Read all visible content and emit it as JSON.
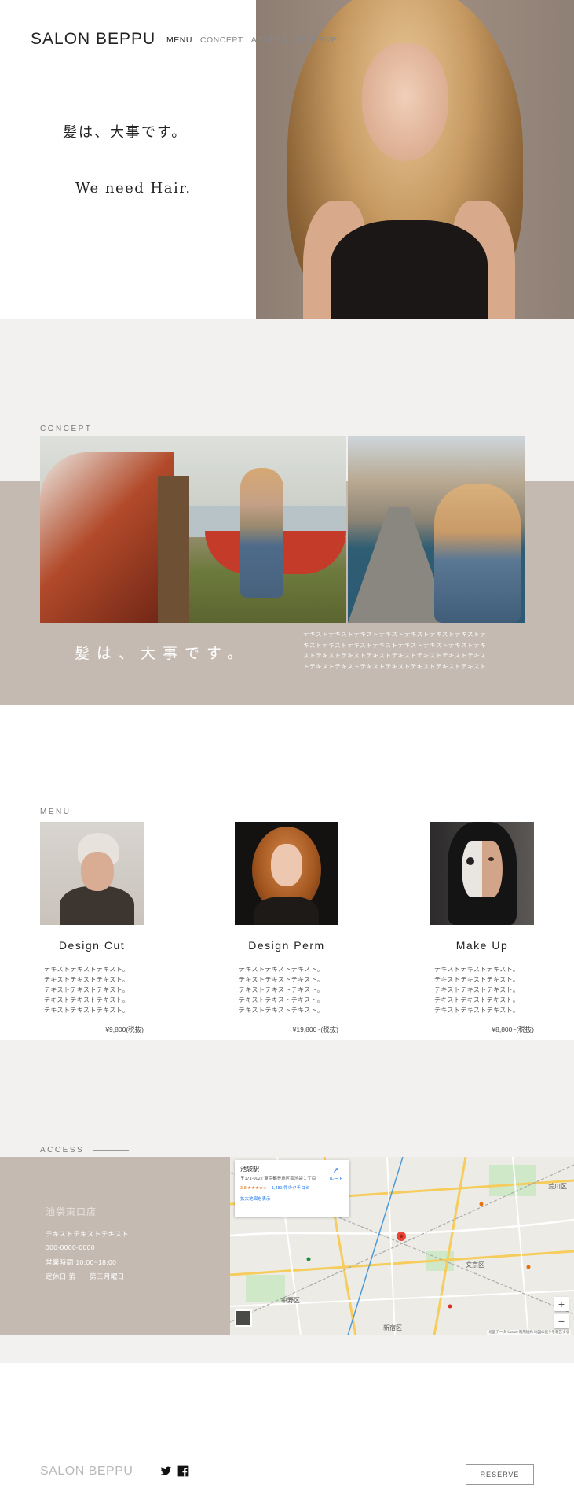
{
  "header": {
    "logo": "SALON BEPPU",
    "nav": [
      {
        "label": "MENU"
      },
      {
        "label": "CONCEPT"
      },
      {
        "label": "ACCESS"
      },
      {
        "label": "RESERVE"
      }
    ]
  },
  "hero": {
    "title_jp": "髪は、大事です。",
    "title_en": "We need Hair."
  },
  "concept": {
    "label": "CONCEPT",
    "heading": "髪は、大事です。",
    "text": "テキストテキストテキストテキストテキストテキストテキストテキストテキストテキストテキストテキストテキストテキストテキストテキストテキストテキストテキストテキストテキストテキストテキストテキストテキストテキストテキストテキストテキスト"
  },
  "menu": {
    "label": "MENU",
    "items": [
      {
        "title": "Design Cut",
        "desc": [
          "テキストテキストテキスト。",
          "テキストテキストテキスト。",
          "テキストテキストテキスト。",
          "テキストテキストテキスト。",
          "テキストテキストテキスト。"
        ],
        "price": "¥9,800(税抜)"
      },
      {
        "title": "Design Perm",
        "desc": [
          "テキストテキストテキスト。",
          "テキストテキストテキスト。",
          "テキストテキストテキスト。",
          "テキストテキストテキスト。",
          "テキストテキストテキスト。"
        ],
        "price": "¥19,800~(税抜)"
      },
      {
        "title": "Make Up",
        "desc": [
          "テキストテキストテキスト。",
          "テキストテキストテキスト。",
          "テキストテキストテキスト。",
          "テキストテキストテキスト。",
          "テキストテキストテキスト。"
        ],
        "price": "¥8,800~(税抜)"
      }
    ]
  },
  "access": {
    "label": "ACCESS",
    "store_name": "池袋東口店",
    "lines": [
      "テキストテキストテキスト",
      "000-0000-0000",
      "営業時間 10:00~18:00",
      "定休日 第一・第三月曜日"
    ],
    "map": {
      "place": "池袋駅",
      "address": "〒171-0022 東京都豊島区南池袋１丁目",
      "rating": "3.8 ★★★★☆",
      "reviews": "1,481 件のクチコミ",
      "route": "ルート",
      "enlarge": "拡大地図を表示",
      "labels": [
        "中野区",
        "文京区",
        "新宿区",
        "荒川区"
      ],
      "footer": "地図データ ©2020  利用規約  地図の誤りを報告する"
    }
  },
  "footer": {
    "logo": "SALON BEPPU",
    "reserve": "RESERVE"
  },
  "colors": {
    "beige": "#c5bab1",
    "light_gray": "#f2f1f0",
    "hero_bg": "#a39284"
  }
}
